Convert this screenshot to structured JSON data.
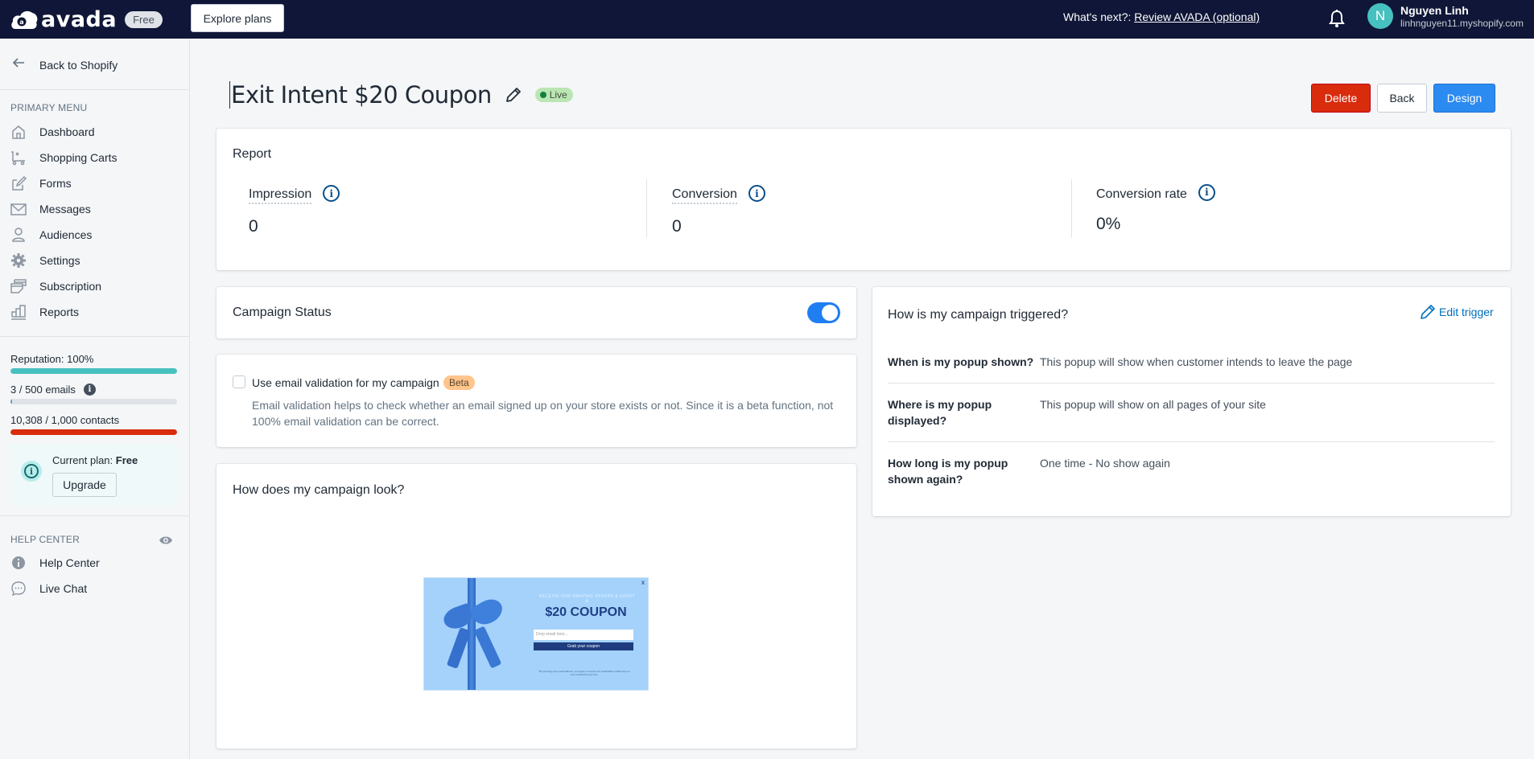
{
  "topbar": {
    "brand": "avada",
    "plan_pill": "Free",
    "explore_plans": "Explore plans",
    "whats_next_label": "What's next?: ",
    "whats_next_link": "Review AVADA (optional)",
    "user_initial": "N",
    "user_name": "Nguyen Linh",
    "user_shop": "linhnguyen11.myshopify.com"
  },
  "sidebar": {
    "back": "Back to Shopify",
    "primary_heading": "PRIMARY MENU",
    "items": [
      {
        "label": "Dashboard",
        "icon": "home-icon"
      },
      {
        "label": "Shopping Carts",
        "icon": "cart-icon"
      },
      {
        "label": "Forms",
        "icon": "form-icon"
      },
      {
        "label": "Messages",
        "icon": "mail-icon"
      },
      {
        "label": "Audiences",
        "icon": "user-icon"
      },
      {
        "label": "Settings",
        "icon": "gear-icon"
      },
      {
        "label": "Subscription",
        "icon": "subscription-icon"
      },
      {
        "label": "Reports",
        "icon": "chart-icon"
      }
    ],
    "reputation": {
      "label": "Reputation: 100%",
      "percent": 100,
      "color": "#47c1bf"
    },
    "emails": {
      "label": "3 / 500 emails",
      "used": 3,
      "total": 500,
      "color": "#5c9de0"
    },
    "contacts": {
      "label": "10,308 / 1,000 contacts",
      "used": 10308,
      "total": 1000,
      "color": "#d82c0d"
    },
    "plan": {
      "prefix": "Current plan: ",
      "name": "Free",
      "upgrade": "Upgrade"
    },
    "help_heading": "HELP CENTER",
    "help_items": [
      {
        "label": "Help Center",
        "icon": "info-icon"
      },
      {
        "label": "Live Chat",
        "icon": "chat-icon"
      }
    ]
  },
  "page": {
    "title": "Exit Intent $20 Coupon",
    "status": "Live",
    "buttons": {
      "delete": "Delete",
      "back": "Back",
      "design": "Design"
    }
  },
  "report": {
    "title": "Report",
    "metrics": [
      {
        "label": "Impression",
        "value": "0"
      },
      {
        "label": "Conversion",
        "value": "0"
      },
      {
        "label": "Conversion rate",
        "value": "0%"
      }
    ]
  },
  "campaign_status": {
    "title": "Campaign Status",
    "enabled": true
  },
  "email_validation": {
    "label": "Use email validation for my campaign",
    "badge": "Beta",
    "checked": false,
    "help": "Email validation helps to check whether an email signed up on your store exists or not. Since it is a beta function, not 100% email validation can be correct."
  },
  "preview": {
    "title": "How does my campaign look?",
    "tagline": "RECEIVE OUR AMAZING OFFERS & ENJOY A",
    "headline": "$20 COUPON",
    "email_placeholder": "Drop email here...",
    "cta": "Grab your coupon",
    "close": "x",
    "fine_print": "*By entering your email address, you agree to receive our marketable emails and you can unsubscribe any time."
  },
  "trigger": {
    "title": "How is my campaign triggered?",
    "edit": "Edit trigger",
    "rows": [
      {
        "q": "When is my popup shown?",
        "a": "This popup will show when customer intends to leave the page"
      },
      {
        "q": "Where is my popup displayed?",
        "a": "This popup will show on all pages of your site"
      },
      {
        "q": "How long is my popup shown again?",
        "a": "One time - No show again"
      }
    ]
  }
}
